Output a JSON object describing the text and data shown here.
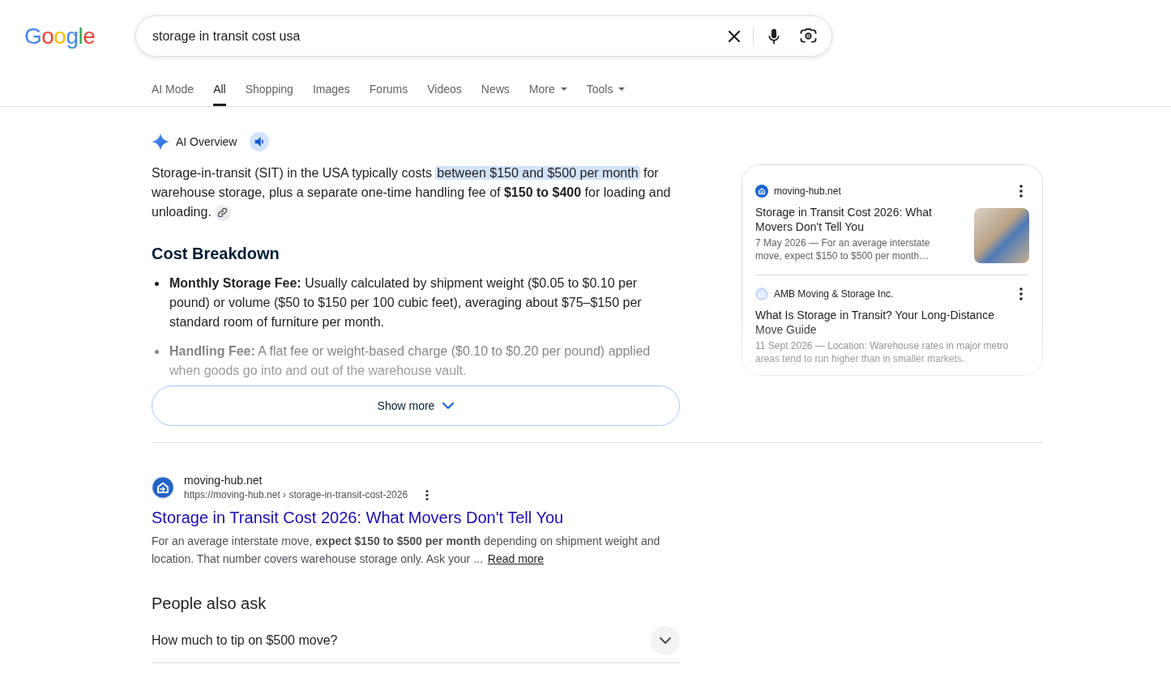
{
  "header": {
    "logo": "Google",
    "search": {
      "value": "storage in transit cost usa"
    }
  },
  "tabs": [
    {
      "label": "AI Mode",
      "kind": "tab",
      "selected": false
    },
    {
      "label": "All",
      "kind": "tab",
      "selected": true
    },
    {
      "label": "Shopping",
      "kind": "tab",
      "selected": false
    },
    {
      "label": "Images",
      "kind": "tab",
      "selected": false
    },
    {
      "label": "Forums",
      "kind": "tab",
      "selected": false
    },
    {
      "label": "Videos",
      "kind": "tab",
      "selected": false
    },
    {
      "label": "News",
      "kind": "tab",
      "selected": false
    },
    {
      "label": "More",
      "kind": "menu",
      "selected": false
    },
    {
      "label": "Tools",
      "kind": "menu",
      "selected": false
    }
  ],
  "ai_overview": {
    "title": "AI Overview",
    "expanded": false,
    "summary": [
      {
        "text": "Storage-in-transit (SIT) in the USA typically costs ",
        "highlighted": false
      },
      {
        "text": "between $150 and $500 per month",
        "highlighted": true
      },
      {
        "text": " for warehouse storage, plus a separate one-time handling fee of **$150 to $400** for loading and unloading.",
        "highlighted": false
      }
    ],
    "section_heading": "Cost Breakdown",
    "bullets": [
      "**Monthly Storage Fee:** Usually calculated by shipment weight ($0.05 to $0.10 per pound) or volume ($50 to $150 per 100 cubic feet), averaging about $75–$150 per standard room of furniture per month.",
      "**Handling Fee:** A flat fee or weight-based charge ($0.10 to $0.20 per pound) applied when goods go into and out of the warehouse vault."
    ],
    "show_more": "Show more",
    "sources": [
      {
        "site": "moving-hub.net",
        "color": "#1a66d2",
        "title": "Storage in Transit Cost 2026: What Movers Don't Tell You",
        "snippet": "7 May 2026 — For an average interstate move, expect $150 to $500 per month…",
        "thumbnail": true
      },
      {
        "site": "AMB Moving & Storage Inc.",
        "color": "#cfe0f7",
        "title": "What Is Storage in Transit? Your Long-Distance Move Guide",
        "snippet": "11 Sept 2026 — Location: Warehouse rates in major metro areas tend to run higher than in smaller markets.",
        "thumbnail": false
      }
    ]
  },
  "result": {
    "site": "moving-hub.net",
    "url": "https://moving-hub.net › storage-in-transit-cost-2026",
    "title": "Storage in Transit Cost 2026: What Movers Don't Tell You",
    "snippet": "For an average interstate move, **expect $150 to $500 per month** depending on shipment weight and location. That number covers warehouse storage only. Ask your ...",
    "read_more": "Read more"
  },
  "people_also_ask": {
    "title": "People also ask",
    "questions": [
      {
        "text": "How much to tip on $500 move?",
        "expanded": false
      }
    ]
  }
}
